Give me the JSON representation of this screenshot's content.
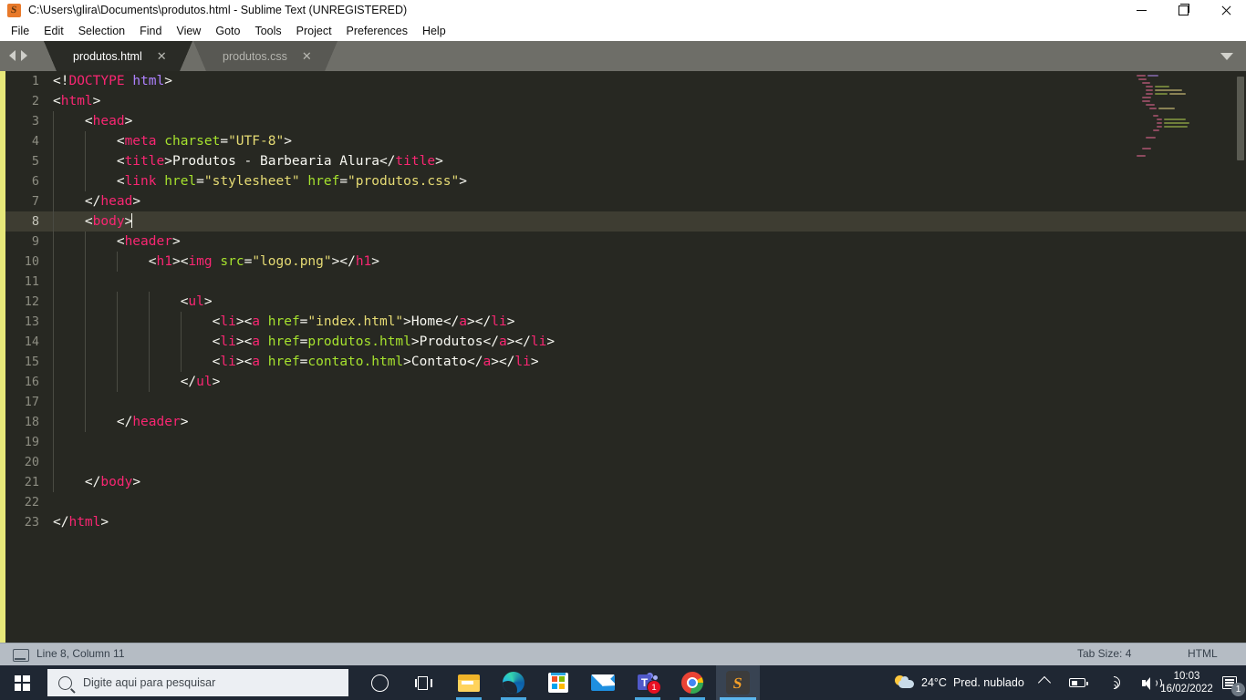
{
  "window": {
    "title": "C:\\Users\\glira\\Documents\\produtos.html - Sublime Text (UNREGISTERED)",
    "app_icon": "sublime-text-icon",
    "icon_letter": "S",
    "controls": {
      "minimize": "minimize-icon",
      "maximize": "restore-icon",
      "close": "close-icon"
    }
  },
  "menubar": {
    "items": [
      {
        "label": "File"
      },
      {
        "label": "Edit"
      },
      {
        "label": "Selection"
      },
      {
        "label": "Find"
      },
      {
        "label": "View"
      },
      {
        "label": "Goto"
      },
      {
        "label": "Tools"
      },
      {
        "label": "Project"
      },
      {
        "label": "Preferences"
      },
      {
        "label": "Help"
      }
    ]
  },
  "tabbar": {
    "nav_prev_icon": "arrow-left-icon",
    "nav_next_icon": "arrow-right-icon",
    "dropdown_icon": "chevron-down-icon",
    "close_glyph": "✕",
    "tabs": [
      {
        "label": "produtos.html",
        "active": true
      },
      {
        "label": "produtos.css",
        "active": false
      }
    ]
  },
  "editor": {
    "active_line": 8,
    "cursor_column": 11,
    "total_lines": 23,
    "line_numbers": [
      1,
      2,
      3,
      4,
      5,
      6,
      7,
      8,
      9,
      10,
      11,
      12,
      13,
      14,
      15,
      16,
      17,
      18,
      19,
      20,
      21,
      22,
      23
    ],
    "lines": [
      {
        "n": 1,
        "text": "<!DOCTYPE html>"
      },
      {
        "n": 2,
        "text": "<html>"
      },
      {
        "n": 3,
        "text": "    <head>"
      },
      {
        "n": 4,
        "text": "        <meta charset=\"UTF-8\">"
      },
      {
        "n": 5,
        "text": "        <title>Produtos - Barbearia Alura</title>"
      },
      {
        "n": 6,
        "text": "        <link hrel=\"stylesheet\" href=\"produtos.css\">"
      },
      {
        "n": 7,
        "text": "    </head>"
      },
      {
        "n": 8,
        "text": "    <body>"
      },
      {
        "n": 9,
        "text": "        <header>"
      },
      {
        "n": 10,
        "text": "            <h1><img src=\"logo.png\"></h1>"
      },
      {
        "n": 11,
        "text": ""
      },
      {
        "n": 12,
        "text": "                <ul>"
      },
      {
        "n": 13,
        "text": "                    <li><a href=\"index.html\">Home</a></li>"
      },
      {
        "n": 14,
        "text": "                    <li><a href=produtos.html>Produtos</a></li>"
      },
      {
        "n": 15,
        "text": "                    <li><a href=contato.html>Contato</a></li>"
      },
      {
        "n": 16,
        "text": "                </ul>"
      },
      {
        "n": 17,
        "text": ""
      },
      {
        "n": 18,
        "text": "        </header>"
      },
      {
        "n": 19,
        "text": ""
      },
      {
        "n": 20,
        "text": ""
      },
      {
        "n": 21,
        "text": "    </body>"
      },
      {
        "n": 22,
        "text": ""
      },
      {
        "n": 23,
        "text": "</html>"
      }
    ],
    "colors": {
      "background": "#272822",
      "active_line": "#3e3d32",
      "tag": "#f92672",
      "attribute": "#a6e22e",
      "string": "#e6db74",
      "keyword": "#ae81ff",
      "text": "#f8f8f2",
      "gutter_text": "#8d8d82",
      "edge_stripe": "#e7e87a"
    }
  },
  "statusbar": {
    "cursor_icon": "editor-pane-icon",
    "position": "Line 8, Column 11",
    "tab_size": "Tab Size: 4",
    "syntax": "HTML"
  },
  "taskbar": {
    "start_icon": "windows-start-icon",
    "search": {
      "icon": "search-icon",
      "placeholder": "Digite aqui para pesquisar",
      "value": ""
    },
    "items": [
      {
        "name": "cortana-icon",
        "label": "Cortana"
      },
      {
        "name": "task-view-icon",
        "label": "Visão de Tarefas"
      },
      {
        "name": "file-explorer-icon",
        "label": "Explorador de Arquivos",
        "running": true
      },
      {
        "name": "microsoft-edge-icon",
        "label": "Microsoft Edge",
        "running": true
      },
      {
        "name": "microsoft-store-icon",
        "label": "Microsoft Store"
      },
      {
        "name": "mail-icon",
        "label": "Email"
      },
      {
        "name": "microsoft-teams-icon",
        "label": "Microsoft Teams",
        "badge": "1",
        "running": true
      },
      {
        "name": "google-chrome-icon",
        "label": "Google Chrome",
        "running": true
      },
      {
        "name": "sublime-text-icon",
        "label": "Sublime Text",
        "active": true
      }
    ]
  },
  "tray": {
    "weather": {
      "icon": "partly-cloudy-icon",
      "temperature": "24°C",
      "condition": "Pred. nublado"
    },
    "icons": [
      {
        "name": "show-hidden-icons-chevron"
      },
      {
        "name": "battery-icon"
      },
      {
        "name": "wifi-icon"
      },
      {
        "name": "volume-icon"
      }
    ],
    "clock": {
      "time": "10:03",
      "date": "16/02/2022"
    },
    "notifications": {
      "icon": "action-center-icon",
      "count": "1"
    }
  },
  "minimap": {
    "visible": true,
    "scrollbar": true
  }
}
